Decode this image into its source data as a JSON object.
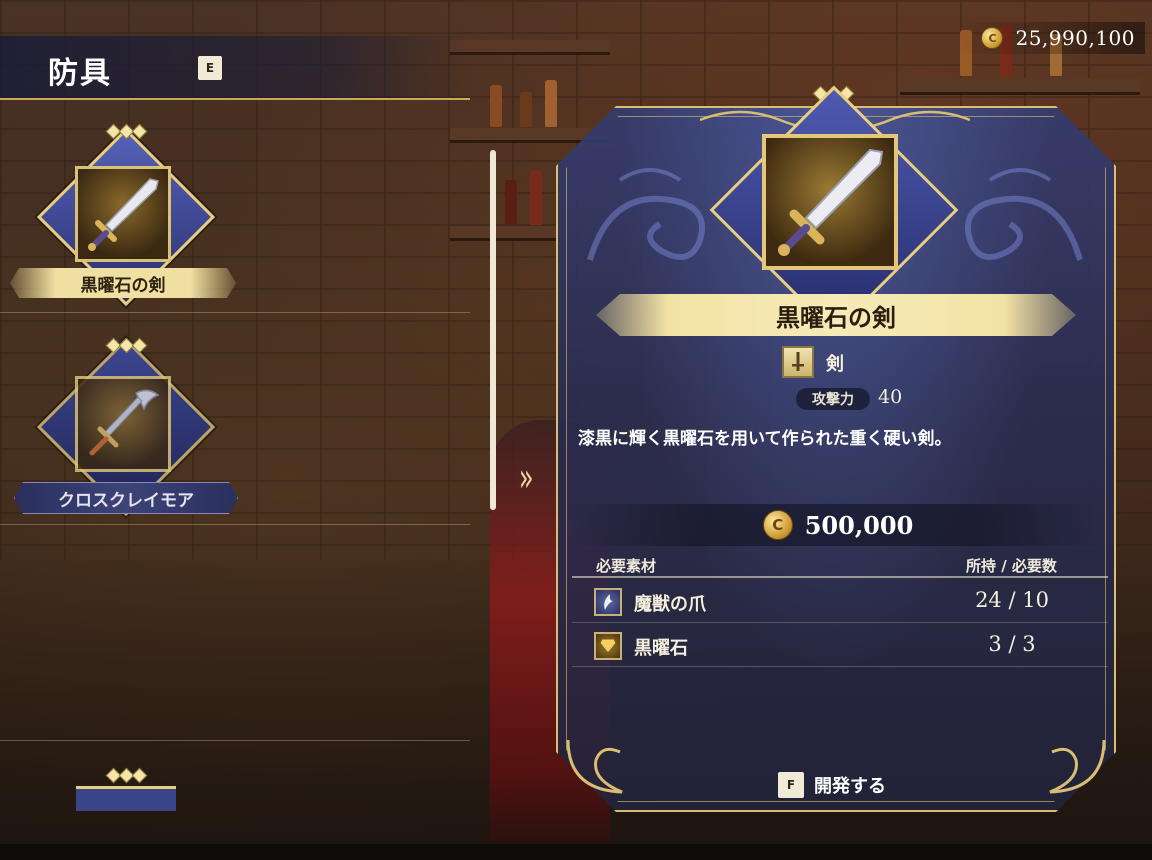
{
  "header": {
    "category_title": "防具",
    "category_key": "E",
    "money": "25,990,100",
    "money_icon": "coin-icon"
  },
  "item_list": [
    {
      "label": "黒曜石の剣",
      "selected": true,
      "icon": "sword-icon"
    },
    {
      "label": "クロスクレイモア",
      "selected": false,
      "icon": "claymore-icon"
    },
    {
      "label": "",
      "selected": false,
      "icon": "weapon-icon"
    }
  ],
  "detail": {
    "name": "黒曜石の剣",
    "type": "剣",
    "type_icon": "sword-type-icon",
    "stat_label": "攻撃力",
    "stat_value": "40",
    "description": "漆黒に輝く黒曜石を用いて作られた重く硬い剣。",
    "price": "500,000",
    "materials_header": "必要素材",
    "count_header": "所持 / 必要数",
    "materials": [
      {
        "name": "魔獣の爪",
        "count": "24 / 10",
        "icon": "claw-icon"
      },
      {
        "name": "黒曜石",
        "count": "3 / 3",
        "icon": "gem-icon"
      }
    ],
    "action_key": "F",
    "action_label": "開発する"
  },
  "colors": {
    "gold": "#d8bd72",
    "panel_blue": "#343c70",
    "label_cream": "#efdfa0"
  }
}
